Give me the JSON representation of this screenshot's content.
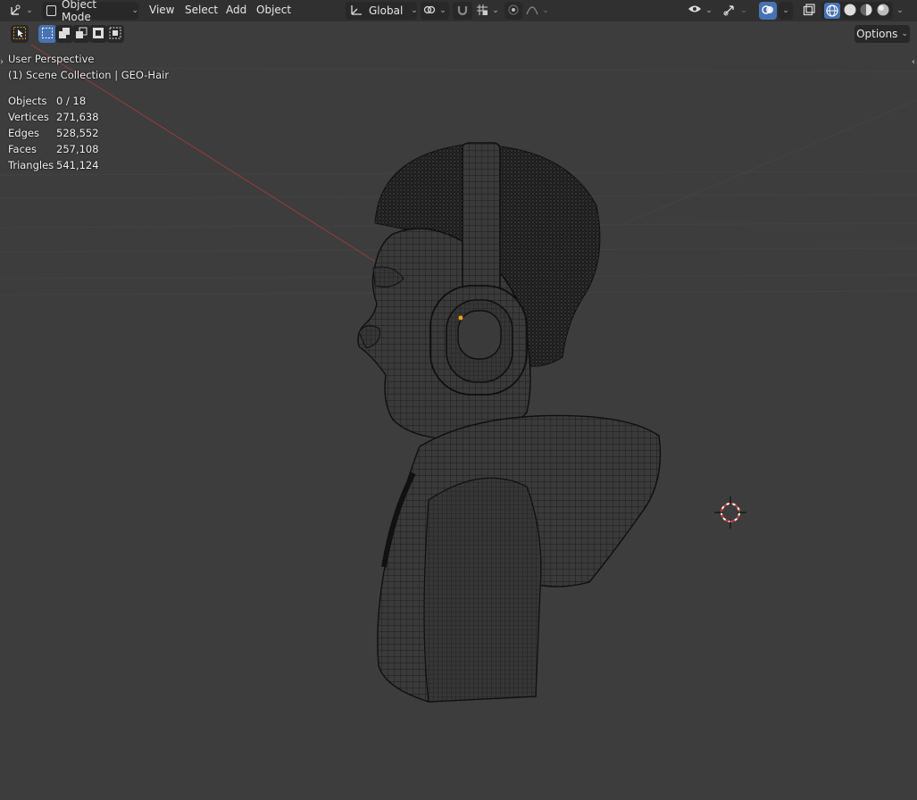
{
  "header": {
    "editor_type_icon": "transform-gizmo-icon",
    "mode_label": "Object Mode",
    "menus": [
      "View",
      "Select",
      "Add",
      "Object"
    ],
    "orientation_label": "Global"
  },
  "toolbar": {
    "options_label": "Options"
  },
  "overlay": {
    "perspective_label": "User Perspective",
    "collection_label": "(1) Scene Collection | GEO-Hair"
  },
  "stats": [
    {
      "label": "Objects",
      "value": "0 / 18"
    },
    {
      "label": "Vertices",
      "value": "271,638"
    },
    {
      "label": "Edges",
      "value": "528,552"
    },
    {
      "label": "Faces",
      "value": "257,108"
    },
    {
      "label": "Triangles",
      "value": "541,124"
    }
  ],
  "colors": {
    "header_bg": "#303030",
    "viewport_bg": "#3d3d3d",
    "accent_active": "#4772b3",
    "x_axis_red": "#b03a3a",
    "wire_color": "#0f0f0f",
    "origin_orange": "#f0a020"
  }
}
